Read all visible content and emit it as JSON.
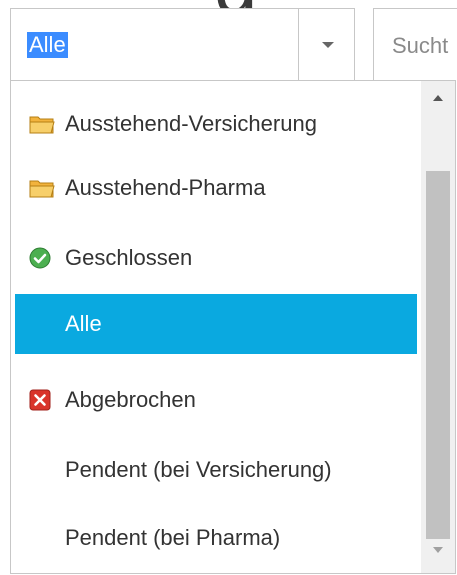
{
  "combo": {
    "selected_value": "Alle",
    "toggle_icon": "chevron-down-icon"
  },
  "search": {
    "placeholder": "Sucht"
  },
  "dropdown": {
    "options": [
      {
        "label": "Ausstehend-Versicherung",
        "icon": "folder-icon",
        "selected": false
      },
      {
        "label": "Ausstehend-Pharma",
        "icon": "folder-icon",
        "selected": false
      },
      {
        "label": "Geschlossen",
        "icon": "check-circle-icon",
        "selected": false
      },
      {
        "label": "Alle",
        "icon": "",
        "selected": true
      },
      {
        "label": "Abgebrochen",
        "icon": "red-x-icon",
        "selected": false
      },
      {
        "label": "Pendent (bei Versicherung)",
        "icon": "",
        "selected": false
      },
      {
        "label": "Pendent (bei Pharma)",
        "icon": "",
        "selected": false
      }
    ]
  },
  "colors": {
    "selected_item_bg": "#0aa9e0",
    "text_selection_bg": "#3b8cff",
    "folder": "#f2b33d",
    "check": "#4caf50",
    "cancel": "#d9342b"
  }
}
